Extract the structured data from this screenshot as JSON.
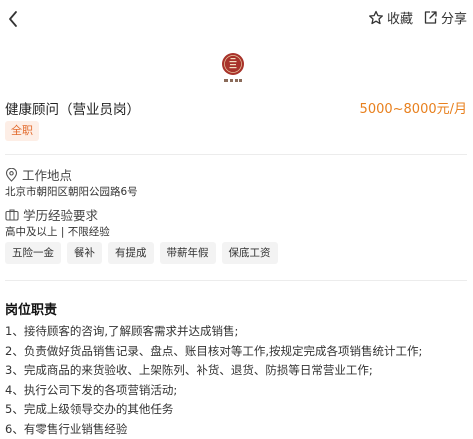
{
  "header": {
    "collect_label": "收藏",
    "share_label": "分享"
  },
  "job": {
    "title": "健康顾问（营业员岗）",
    "salary": "5000~8000元/月",
    "type_tag": "全职"
  },
  "location": {
    "heading": "工作地点",
    "address": "北京市朝阳区朝阳公园路6号"
  },
  "requirements": {
    "heading": "学历经验要求",
    "value": "高中及以上 | 不限经验"
  },
  "benefits": [
    "五险一金",
    "餐补",
    "有提成",
    "带薪年假",
    "保底工资"
  ],
  "duties": {
    "heading": "岗位职责",
    "items": [
      "1、接待顾客的咨询,了解顾客需求并达成销售;",
      "2、负责做好货品销售记录、盘点、账目核对等工作,按规定完成各项销售统计工作;",
      "3、完成商品的来货验收、上架陈列、补货、退货、防损等日常营业工作;",
      "4、执行公司下发的各项营销活动;",
      "5、完成上级领导交办的其他任务",
      "6、有零售行业销售经验"
    ]
  },
  "colors": {
    "accent_orange": "#e8801e",
    "tag_text": "#e26a2c",
    "tag_bg": "#fdeee6",
    "logo_red": "#a8322a"
  },
  "icons": {
    "back": "chevron-left-icon",
    "collect": "star-outline-icon",
    "share": "share-icon",
    "location": "location-pin-icon",
    "education": "briefcase-icon"
  }
}
